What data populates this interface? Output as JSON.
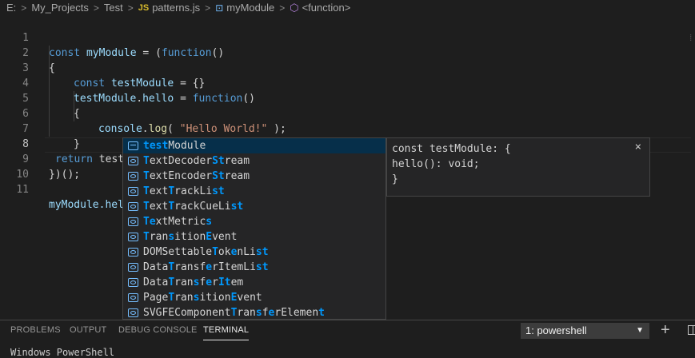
{
  "breadcrumb": {
    "items": [
      "E:",
      "My_Projects",
      "Test",
      "patterns.js",
      "myModule",
      "<function>"
    ],
    "js_badge": "JS",
    "separator": ">"
  },
  "editor": {
    "lines": [
      {
        "n": "1"
      },
      {
        "n": "2"
      },
      {
        "n": "3"
      },
      {
        "n": "4"
      },
      {
        "n": "5"
      },
      {
        "n": "6"
      },
      {
        "n": "7"
      },
      {
        "n": "8"
      },
      {
        "n": "9"
      },
      {
        "n": "10"
      },
      {
        "n": "11"
      }
    ],
    "tokens": {
      "const": "const",
      "myModule": "myModule",
      "eq": " = (",
      "function": "function",
      "paren": "()",
      "brace_open": "{",
      "brace_close": "}",
      "testModule": "testModule",
      "obj_init": " = {}",
      "testModule_hello_obj": "testModule",
      "dot": ".",
      "hello": "hello",
      "eq2": " = ",
      "console": "console",
      "log": "log",
      "open_call": "( ",
      "hello_str": "\"Hello World!\"",
      "close_call": " );",
      "return": "return",
      "test_semicolon": " test;",
      "iife_close": "})();",
      "myModule_partial": "myModule.hel"
    }
  },
  "suggest": {
    "items": [
      {
        "label": "testModule",
        "match": [
          0,
          4
        ],
        "selected": true,
        "kind": "variable"
      },
      {
        "label": "TextDecoderStream",
        "match": "T|e|xtDecoder|S|t|ream"
      },
      {
        "label": "TextEncoderStream"
      },
      {
        "label": "TextTrackList"
      },
      {
        "label": "TextTrackCueList"
      },
      {
        "label": "TextMetrics"
      },
      {
        "label": "TransitionEvent"
      },
      {
        "label": "DOMSettableTokenList"
      },
      {
        "label": "DataTransferItemList"
      },
      {
        "label": "DataTransferItem"
      },
      {
        "label": "PageTransitionEvent"
      },
      {
        "label": "SVGFEComponentTransferElement"
      }
    ]
  },
  "details": {
    "lines": [
      "const testModule: {",
      "hello(): void;",
      "}"
    ],
    "close": "×"
  },
  "panel": {
    "tabs": [
      "PROBLEMS",
      "OUTPUT",
      "DEBUG CONSOLE",
      "TERMINAL"
    ],
    "active_tab": "TERMINAL",
    "terminal_select": "1: powershell",
    "chevron": "▼",
    "plus": "+",
    "terminal_text": "Windows PowerShell"
  },
  "colors": {
    "background": "#1e1e1e",
    "keyword": "#569cd6",
    "variable": "#9cdcfe",
    "function": "#dcdcaa",
    "string": "#ce9178",
    "match_highlight": "#0097fb",
    "selected_item": "#062f4a"
  }
}
